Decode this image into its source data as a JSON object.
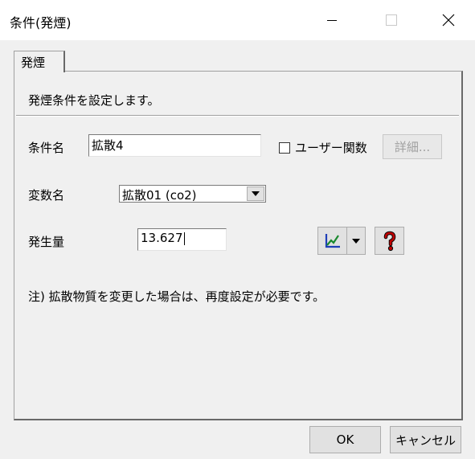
{
  "window": {
    "title": "条件(発煙)"
  },
  "tabs": [
    {
      "label": "発煙"
    }
  ],
  "panel": {
    "description": "発煙条件を設定します。",
    "condition_name": {
      "label": "条件名",
      "value": "拡散4"
    },
    "user_function": {
      "label": "ユーザー関数",
      "checked": false
    },
    "detail_button": {
      "label": "詳細..."
    },
    "variable_name": {
      "label": "変数名",
      "selected": "拡散01 (co2)"
    },
    "generation": {
      "label": "発生量",
      "value": "13.627"
    },
    "note": "注) 拡散物質を変更した場合は、再度設定が必要です。"
  },
  "footer": {
    "ok_label": "OK",
    "cancel_label": "キャンセル"
  },
  "icons": {
    "graph": "line-chart-icon",
    "help": "question-mark-icon"
  },
  "colors": {
    "accent_red": "#c00000",
    "graph_green": "#1a8a2e",
    "graph_blue": "#1f3fb8"
  }
}
